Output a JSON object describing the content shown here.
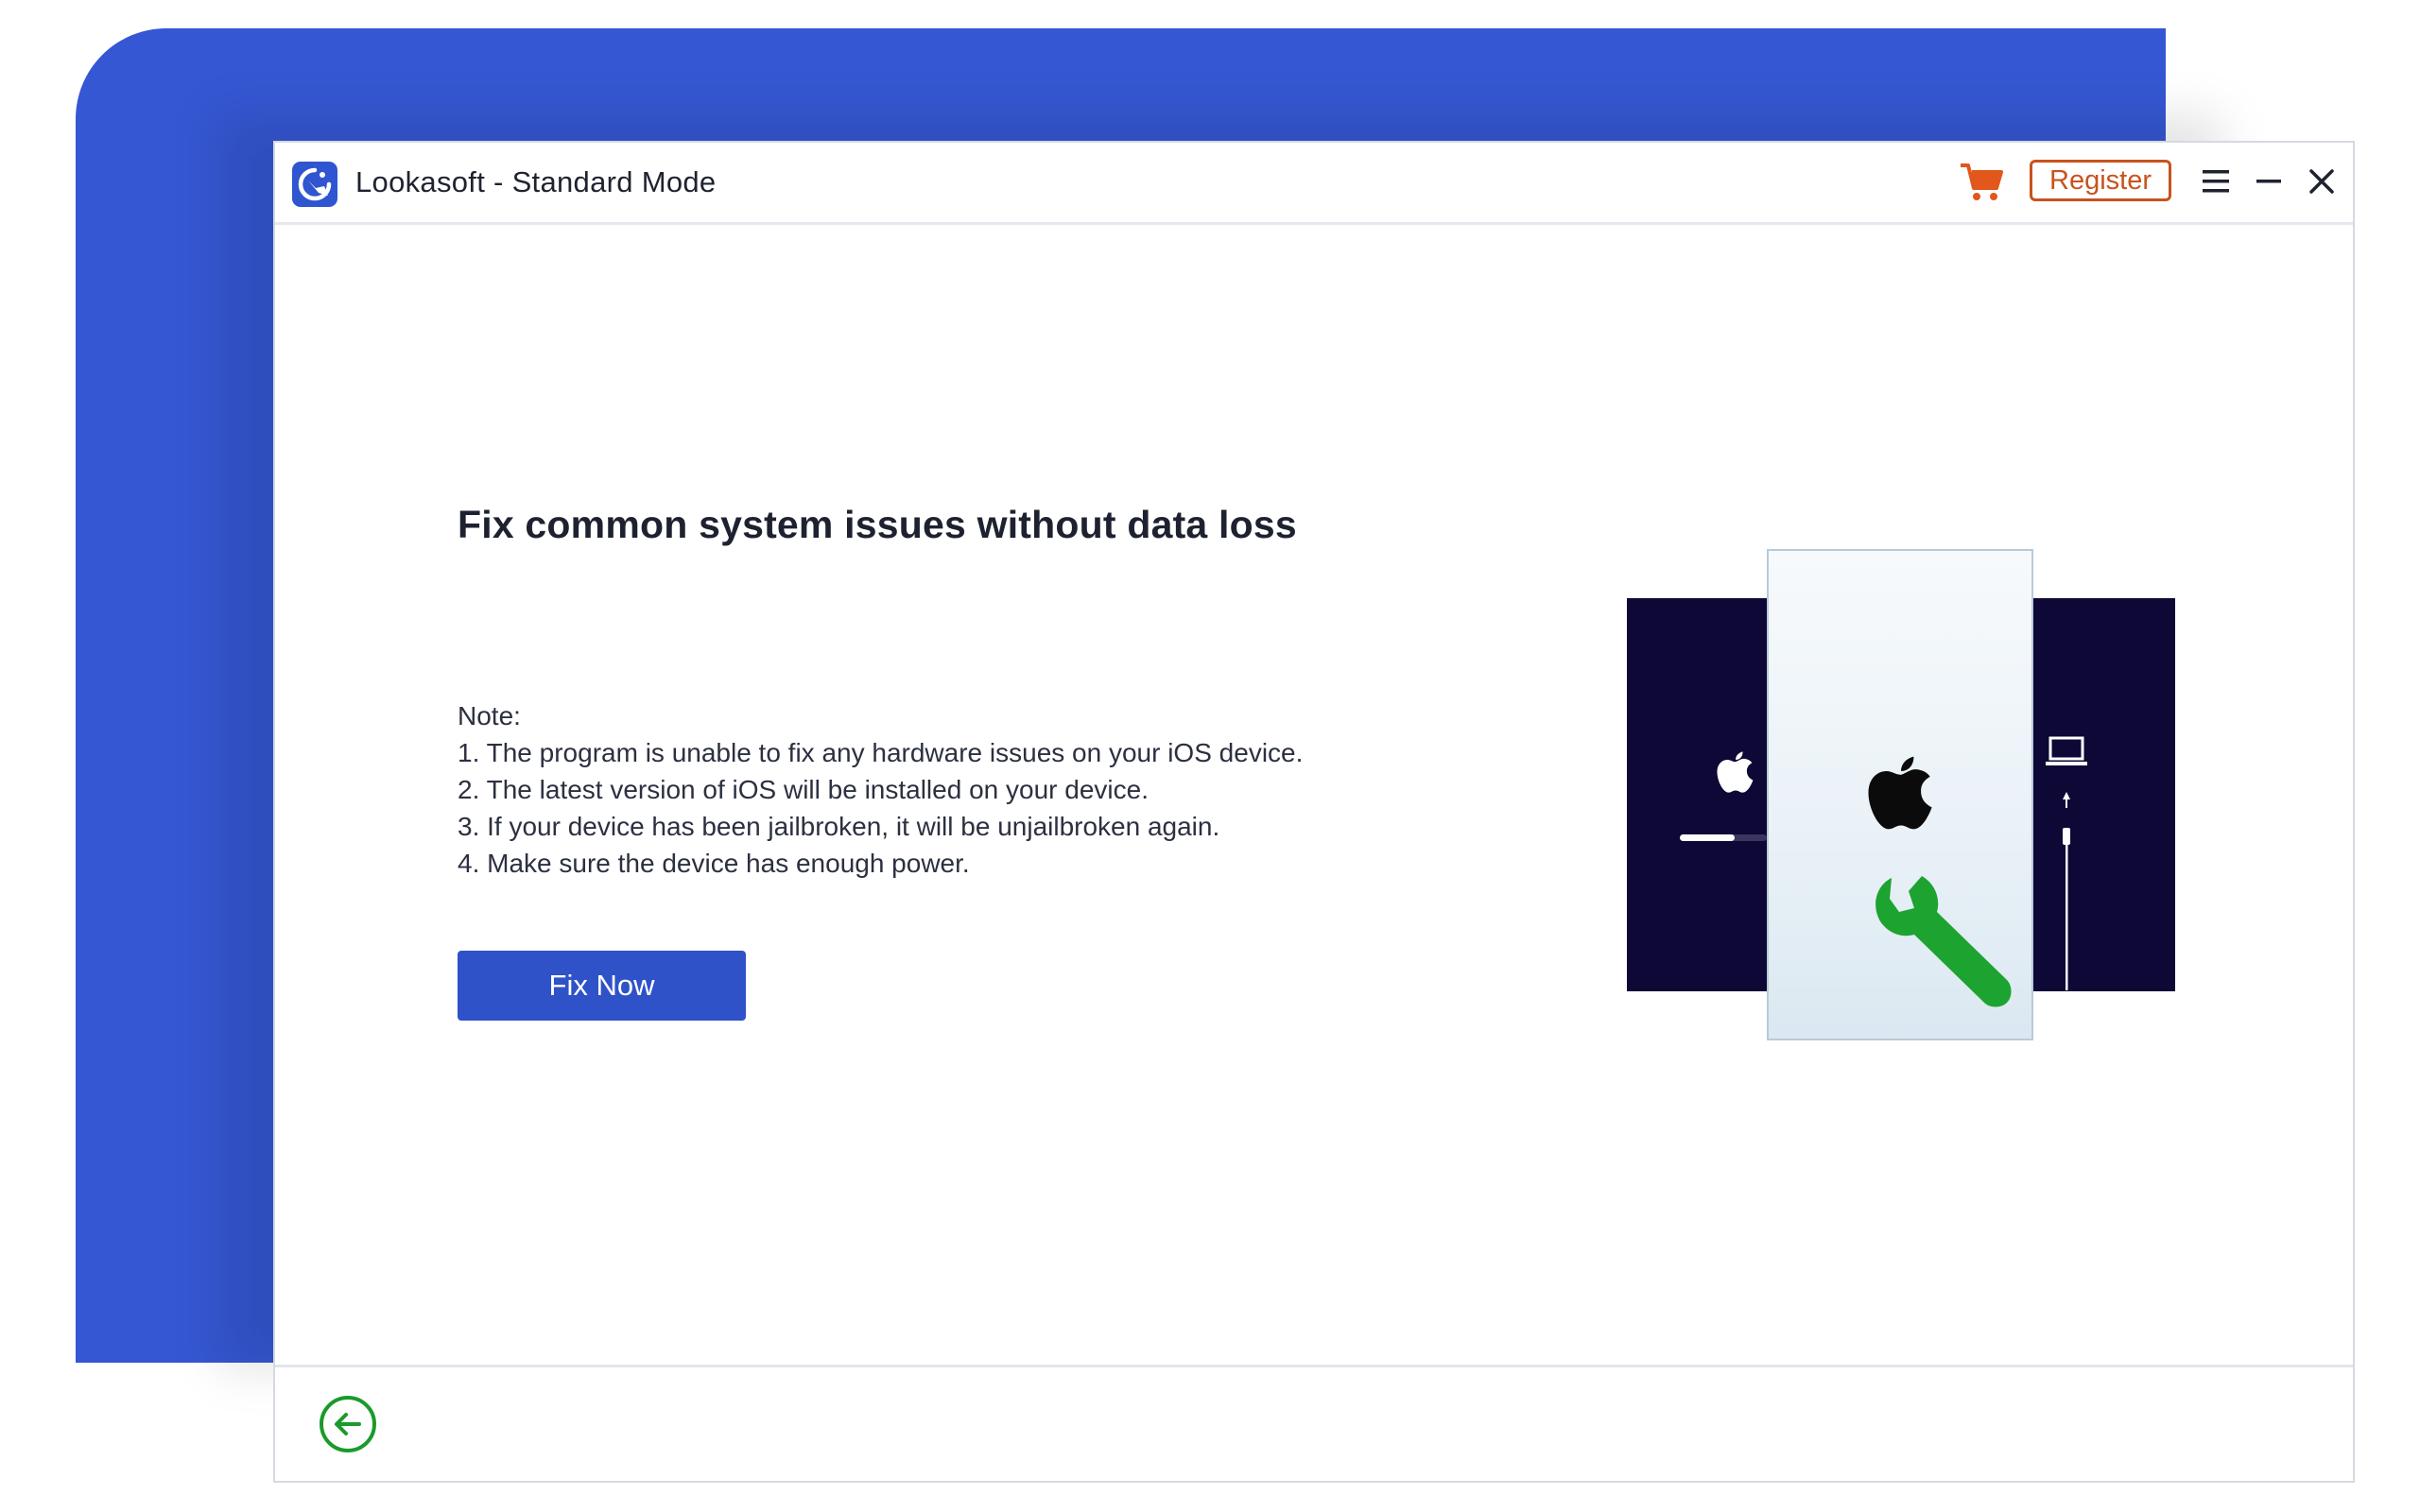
{
  "window": {
    "title": "Lookasoft - Standard Mode",
    "register_label": "Register",
    "icons": {
      "logo": "lookasoft-logo-icon",
      "cart": "cart-icon",
      "menu": "menu-icon",
      "minimize": "minimize-icon",
      "close": "close-icon"
    }
  },
  "main": {
    "heading": "Fix common system issues without data loss",
    "note_title": "Note:",
    "notes": [
      "1. The program is unable to fix any hardware issues on your iOS device.",
      "2. The latest version of iOS will be installed on your device.",
      "3. If your device has been jailbroken, it will be unjailbroken again.",
      "4. Make sure the device has enough power."
    ],
    "fix_button": "Fix Now"
  },
  "footer": {
    "back_icon": "back-arrow-icon"
  },
  "colors": {
    "brand_blue": "#3557d3",
    "button_blue": "#2f52c8",
    "register_orange": "#c9521d",
    "cart_orange": "#e2571c",
    "wrench_green": "#1da32f",
    "back_green": "#1a9a2a",
    "illustration_dark": "#0d0835"
  }
}
